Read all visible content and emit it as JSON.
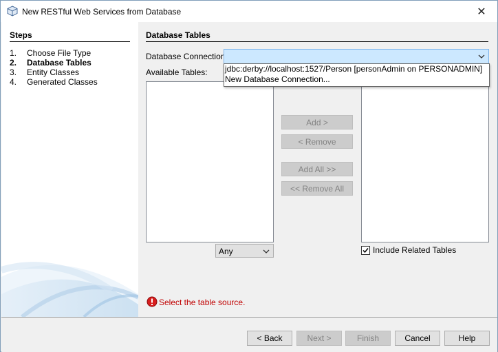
{
  "window": {
    "title": "New RESTful Web Services from Database",
    "close_glyph": "✕"
  },
  "steps": {
    "title": "Steps",
    "items": [
      {
        "num": "1.",
        "label": "Choose File Type",
        "current": false
      },
      {
        "num": "2.",
        "label": "Database Tables",
        "current": true
      },
      {
        "num": "3.",
        "label": "Entity Classes",
        "current": false
      },
      {
        "num": "4.",
        "label": "Generated Classes",
        "current": false
      }
    ]
  },
  "content": {
    "section_title": "Database Tables",
    "connection_label": "Database Connection:",
    "connection_value": "",
    "dropdown_options": [
      "jdbc:derby://localhost:1527/Person [personAdmin on PERSONADMIN]",
      "New Database Connection..."
    ],
    "available_tables_label": "Available Tables:",
    "buttons": {
      "add": "Add >",
      "remove": "< Remove",
      "add_all": "Add All >>",
      "remove_all": "<< Remove All"
    },
    "filter_value": "Any",
    "include_related_label": "Include Related Tables",
    "include_related_checked": true,
    "error_message": "Select the table source."
  },
  "footer": {
    "back": "< Back",
    "next": "Next >",
    "finish": "Finish",
    "cancel": "Cancel",
    "help": "Help"
  },
  "colors": {
    "combo_highlight": "#cce8ff",
    "error_red": "#c00000",
    "disabled_text": "#838383"
  }
}
